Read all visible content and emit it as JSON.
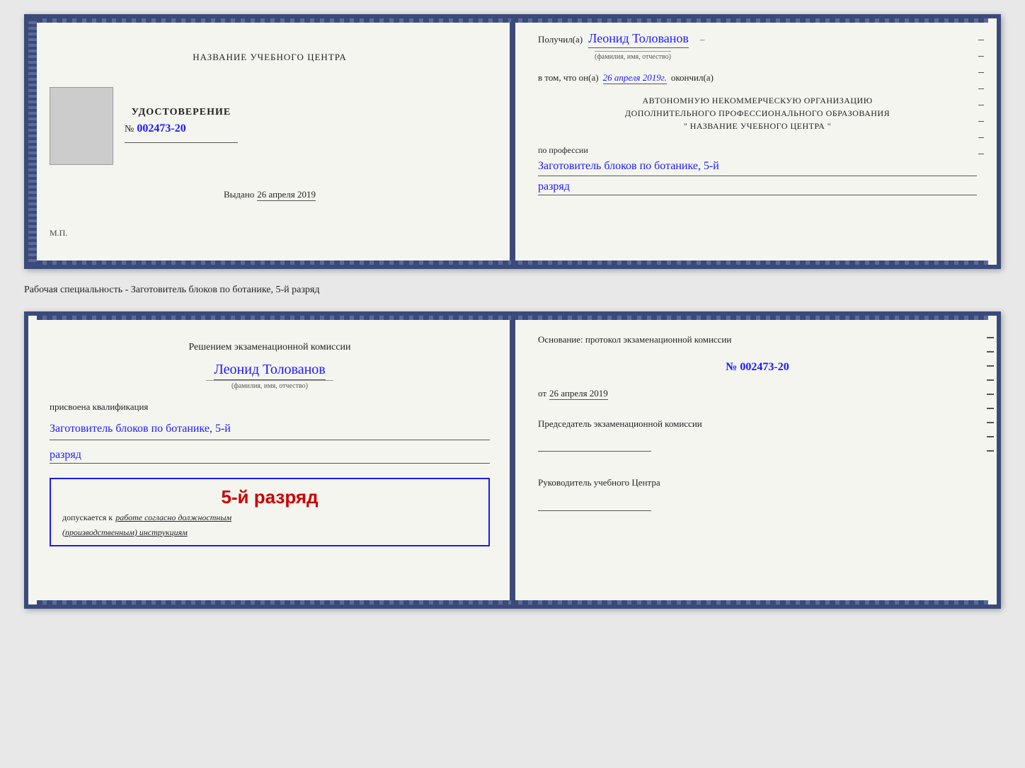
{
  "top_cert": {
    "left": {
      "training_center_label": "НАЗВАНИЕ УЧЕБНОГО ЦЕНТРА",
      "cert_title": "УДОСТОВЕРЕНИЕ",
      "cert_number_prefix": "№",
      "cert_number": "002473-20",
      "issued_label": "Выдано",
      "issued_date": "26 апреля 2019",
      "mp_label": "М.П."
    },
    "right": {
      "received_label": "Получил(а)",
      "recipient_name": "Леонид Толованов",
      "fio_label": "(фамилия, имя, отчество)",
      "in_that_label": "в том, что он(а)",
      "completed_date": "26 апреля 2019г.",
      "completed_label": "окончил(а)",
      "org_line1": "АВТОНОМНУЮ НЕКОММЕРЧЕСКУЮ ОРГАНИЗАЦИЮ",
      "org_line2": "ДОПОЛНИТЕЛЬНОГО ПРОФЕССИОНАЛЬНОГО ОБРАЗОВАНИЯ",
      "org_line3": "\"  НАЗВАНИЕ УЧЕБНОГО ЦЕНТРА  \"",
      "profession_label": "по профессии",
      "profession_name": "Заготовитель блоков по ботанике, 5-й",
      "rank_name": "разряд"
    }
  },
  "specialty_label": "Рабочая специальность - Заготовитель блоков по ботанике, 5-й разряд",
  "bottom_cert": {
    "left": {
      "decision_text": "Решением экзаменационной комиссии",
      "person_name": "Леонид Толованов",
      "fio_label": "(фамилия, имя, отчество)",
      "assigned_label": "присвоена квалификация",
      "qual_name": "Заготовитель блоков по ботанике, 5-й",
      "qual_rank": "разряд",
      "rank_box_title": "5-й разряд",
      "admitted_label": "допускается к",
      "admitted_text": "работе согласно должностным",
      "admitted_text2": "(производственным) инструкциям"
    },
    "right": {
      "basis_label": "Основание: протокол экзаменационной комиссии",
      "protocol_number": "№  002473-20",
      "date_prefix": "от",
      "protocol_date": "26 апреля 2019",
      "chair_title": "Председатель экзаменационной комиссии",
      "head_title": "Руководитель учебного Центра"
    }
  }
}
